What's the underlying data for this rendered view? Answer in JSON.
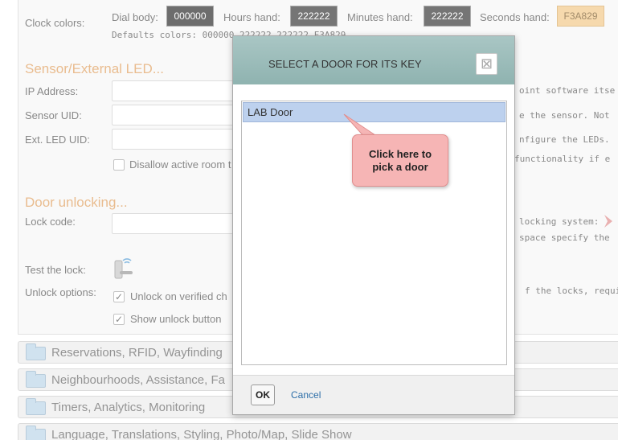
{
  "clock": {
    "label": "Clock colors:",
    "dial_label": "Dial body:",
    "dial_value": "000000",
    "hours_label": "Hours hand:",
    "hours_value": "222222",
    "minutes_label": "Minutes hand:",
    "minutes_value": "222222",
    "seconds_label": "Seconds hand:",
    "seconds_value": "F3A829",
    "defaults_text": "Defaults colors: 000000,222222,222222,F3A829"
  },
  "sensor": {
    "section_title": "Sensor/External LED...",
    "ip_label": "IP Address:",
    "uid_label": "Sensor UID:",
    "ext_led_label": "Ext. LED UID:",
    "disallow_label": "Disallow active room t",
    "hint_1": "oint software itse",
    "hint_2": "e the sensor. Not",
    "hint_3": "nfigure the LEDs.",
    "hint_4": "functionality if e"
  },
  "door": {
    "section_title": "Door unlocking...",
    "lock_code_label": "Lock code:",
    "test_label": "Test the lock:",
    "unlock_options_label": "Unlock options:",
    "unlock_verified_label": "Unlock on verified ch",
    "show_unlock_label": "Show unlock button",
    "hint_1": "locking system:",
    "hint_2": "space specify the",
    "hint_3": "f the locks, requi"
  },
  "accordions": [
    {
      "title": "Reservations, RFID, Wayfinding"
    },
    {
      "title": "Neighbourhoods, Assistance, Fa"
    },
    {
      "title": "Timers, Analytics, Monitoring"
    },
    {
      "title": "Language, Translations, Styling, Photo/Map, Slide Show"
    }
  ],
  "modal": {
    "title": "SELECT A DOOR FOR ITS KEY",
    "close_glyph": "⊠",
    "items": [
      {
        "label": "LAB Door"
      }
    ],
    "ok_label": "OK",
    "cancel_label": "Cancel"
  },
  "callout": {
    "line1": "Click here to",
    "line2": "pick a door"
  },
  "colors": {
    "section_accent": "#e0a05f",
    "modal_header": "#9dbdbb",
    "selected_item": "#bdd1ee",
    "callout_fill": "#f6b5b5",
    "seconds_swatch": "#f3a829"
  }
}
